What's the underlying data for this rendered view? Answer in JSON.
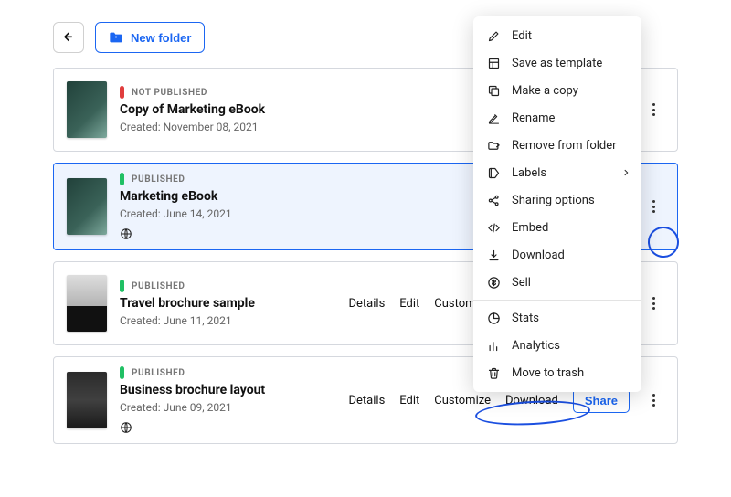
{
  "toolbar": {
    "new_folder_label": "New folder"
  },
  "rows": [
    {
      "status": "NOT PUBLISHED",
      "published": false,
      "title": "Copy of Marketing eBook",
      "created": "Created: November 08, 2021",
      "selected": false,
      "globe": false,
      "thumb": "marketing"
    },
    {
      "status": "PUBLISHED",
      "published": true,
      "title": "Marketing eBook",
      "created": "Created: June 14, 2021",
      "selected": true,
      "globe": true,
      "thumb": "marketing"
    },
    {
      "status": "PUBLISHED",
      "published": true,
      "title": "Travel brochure sample",
      "created": "Created: June 11, 2021",
      "selected": false,
      "globe": false,
      "thumb": "travel"
    },
    {
      "status": "PUBLISHED",
      "published": true,
      "title": "Business brochure layout",
      "created": "Created: June 09, 2021",
      "selected": false,
      "globe": true,
      "thumb": "biz"
    }
  ],
  "row_actions": {
    "details": "Details",
    "edit": "Edit",
    "customize": "Customize",
    "customize_cut": "Cus",
    "download": "Download",
    "share": "Share"
  },
  "menu": [
    {
      "icon": "edit",
      "label": "Edit"
    },
    {
      "icon": "template",
      "label": "Save as template"
    },
    {
      "icon": "copy",
      "label": "Make a copy"
    },
    {
      "icon": "rename",
      "label": "Rename"
    },
    {
      "icon": "remove",
      "label": "Remove from folder"
    },
    {
      "icon": "labels",
      "label": "Labels",
      "submenu": true
    },
    {
      "icon": "share",
      "label": "Sharing options"
    },
    {
      "icon": "embed",
      "label": "Embed"
    },
    {
      "icon": "download",
      "label": "Download"
    },
    {
      "icon": "sell",
      "label": "Sell"
    },
    {
      "sep": true
    },
    {
      "icon": "stats",
      "label": "Stats"
    },
    {
      "icon": "analytics",
      "label": "Analytics"
    },
    {
      "icon": "trash",
      "label": "Move to trash",
      "highlighted": true
    }
  ]
}
